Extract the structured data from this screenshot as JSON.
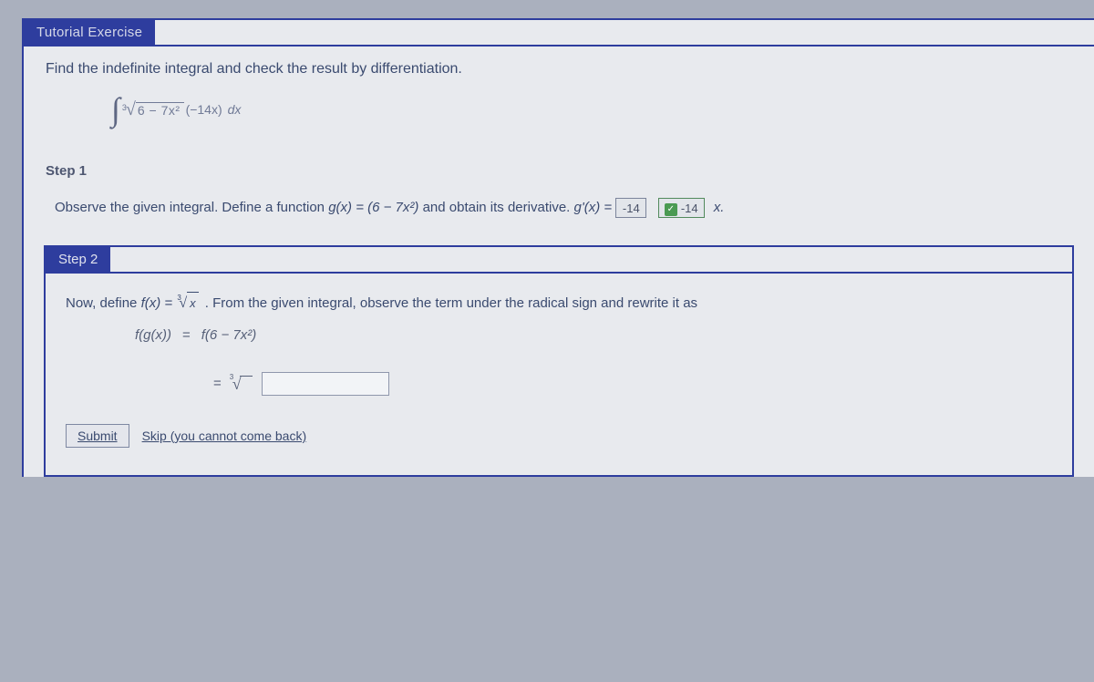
{
  "header": {
    "title": "Tutorial Exercise"
  },
  "problem": {
    "text": "Find the indefinite integral and check the result by differentiation.",
    "integral_radicand": "6 − 7x²",
    "integral_outer": "(−14x)",
    "dx": "dx"
  },
  "step1": {
    "label": "Step 1",
    "body_pre": "Observe the given integral. Define a function ",
    "g_def": "g(x) = (6 − 7x²)",
    "body_mid": " and obtain its derivative. ",
    "gprime": "g'(x) = ",
    "answer1": "-14",
    "answer2": "-14",
    "x_suffix": "x."
  },
  "step2": {
    "label": "Step 2",
    "line1_pre": "Now, define ",
    "fx_eq": "f(x) = ",
    "root_x": "x",
    "line1_post": ". From the given integral, observe the term under the radical sign and rewrite it as",
    "eq1_lhs": "f(g(x))",
    "eq1_rhs": "f(6 − 7x²)",
    "eq2_prefix": "="
  },
  "buttons": {
    "submit": "Submit",
    "skip": "Skip (you cannot come back)"
  }
}
